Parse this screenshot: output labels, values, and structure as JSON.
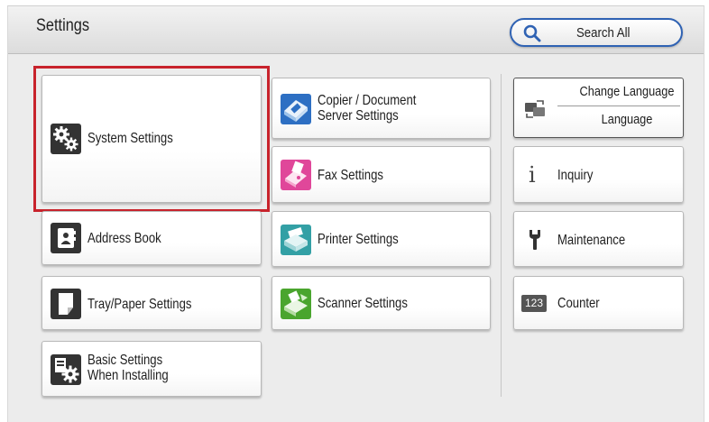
{
  "header": {
    "title": "Settings",
    "search_label": "Search All"
  },
  "tiles": {
    "system_settings": "System Settings",
    "address_book": "Address Book",
    "tray_paper": "Tray/Paper Settings",
    "basic_settings_line1": "Basic Settings",
    "basic_settings_line2": "When Installing",
    "copier_line1": "Copier / Document",
    "copier_line2": "Server Settings",
    "fax": "Fax Settings",
    "printer": "Printer Settings",
    "scanner": "Scanner Settings",
    "change_language": "Change Language",
    "language": "Language",
    "inquiry": "Inquiry",
    "maintenance": "Maintenance",
    "counter": "Counter",
    "counter_icon_text": "123"
  },
  "colors": {
    "highlight": "#c8232c",
    "search_border": "#2f62b3",
    "copier_icon": "#2d6fc3",
    "fax_icon": "#e0479a",
    "printer_icon": "#33a0a5",
    "scanner_icon": "#4aa52e",
    "dark_icon": "#333333"
  },
  "icons": {
    "search": "magnifier-icon",
    "system": "gears-icon",
    "address_book": "contact-card-icon",
    "tray": "paper-sheet-icon",
    "basic": "install-gear-icon",
    "copier": "copier-icon",
    "fax": "fax-icon",
    "printer": "printer-icon",
    "scanner": "scanner-icon",
    "language": "language-swap-icon",
    "inquiry": "info-icon",
    "maintenance": "wrench-icon",
    "counter": "counter-123-icon"
  }
}
